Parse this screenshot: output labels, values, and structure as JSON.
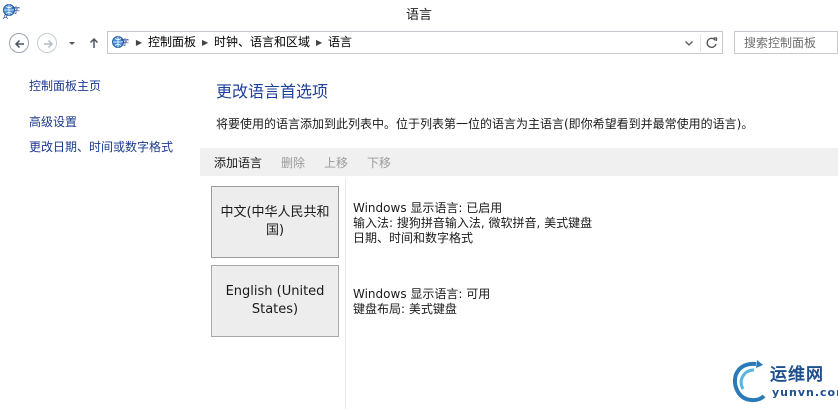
{
  "window": {
    "title": "语言",
    "app_icon": "control-panel-globe-icon"
  },
  "navbar": {
    "back_icon": "back-arrow-icon",
    "forward_icon": "forward-arrow-icon",
    "recent_icon": "chevron-down-icon",
    "up_icon": "up-arrow-icon",
    "breadcrumbs": [
      "控制面板",
      "时钟、语言和区域",
      "语言"
    ],
    "search_placeholder": "搜索控制面板"
  },
  "sidebar": {
    "items": [
      {
        "label": "控制面板主页"
      },
      {
        "label": "高级设置"
      },
      {
        "label": "更改日期、时间或数字格式"
      }
    ]
  },
  "main": {
    "heading": "更改语言首选项",
    "description": "将要使用的语言添加到此列表中。位于列表第一位的语言为主语言(即你希望看到并最常使用的语言)。",
    "toolbar": {
      "add": "添加语言",
      "remove": "删除",
      "move_up": "上移",
      "move_down": "下移"
    },
    "languages": [
      {
        "name": "中文(中华人民共和国)",
        "details": [
          "Windows 显示语言: 已启用",
          "输入法: 搜狗拼音输入法, 微软拼音, 美式键盘",
          "日期、时间和数字格式"
        ]
      },
      {
        "name": "English (United States)",
        "details": [
          "Windows 显示语言: 可用",
          "键盘布局: 美式键盘"
        ]
      }
    ]
  },
  "watermark": {
    "name": "运维网",
    "url": "yunvn.com"
  },
  "colors": {
    "link": "#1a3a8f",
    "heading": "#1e3f9c",
    "toolbar_bg": "#f0f0f0",
    "disabled": "#9a9a9a",
    "tile_bg": "#ededed"
  }
}
